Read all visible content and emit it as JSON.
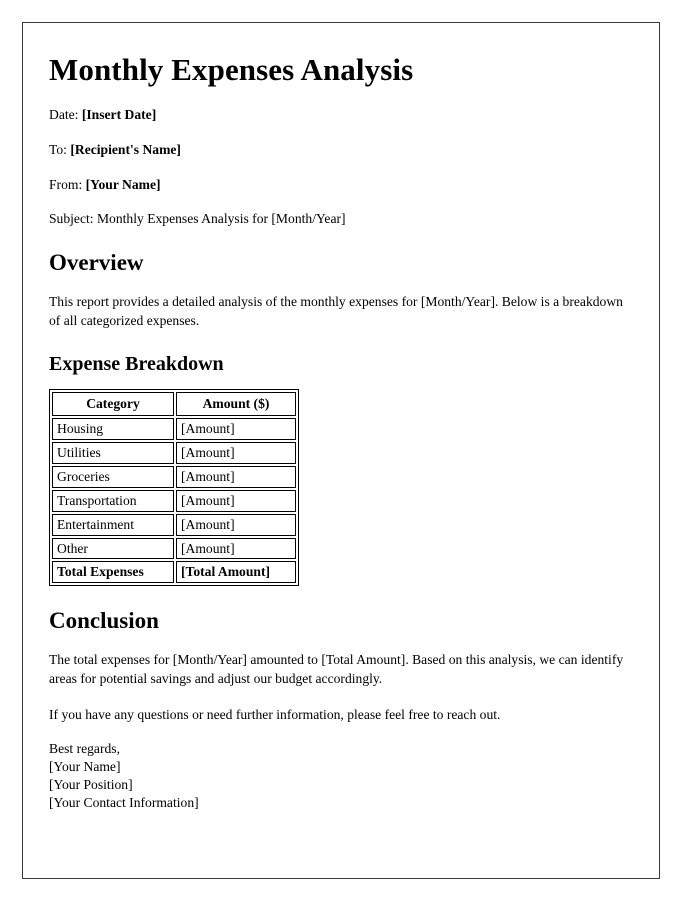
{
  "document": {
    "title": "Monthly Expenses Analysis",
    "meta": [
      {
        "label": "Date:",
        "value": "[Insert Date]",
        "bold_value": true
      },
      {
        "label": "To:",
        "value": "[Recipient's Name]",
        "bold_value": true
      },
      {
        "label": "From:",
        "value": "[Your Name]",
        "bold_value": true
      },
      {
        "label": "Subject:",
        "value": "Monthly Expenses Analysis for [Month/Year]",
        "bold_value": false
      }
    ],
    "overview": {
      "heading": "Overview",
      "paragraph": "This report provides a detailed analysis of the monthly expenses for [Month/Year]. Below is a breakdown of all categorized expenses."
    },
    "expense_breakdown": {
      "heading": "Expense Breakdown",
      "table": {
        "columns": [
          "Category",
          "Amount ($)"
        ],
        "rows": [
          [
            "Housing",
            "[Amount]"
          ],
          [
            "Utilities",
            "[Amount]"
          ],
          [
            "Groceries",
            "[Amount]"
          ],
          [
            "Transportation",
            "[Amount]"
          ],
          [
            "Entertainment",
            "[Amount]"
          ],
          [
            "Other",
            "[Amount]"
          ]
        ],
        "total_row": [
          "Total Expenses",
          "[Total Amount]"
        ]
      }
    },
    "conclusion": {
      "heading": "Conclusion",
      "paragraph_1": "The total expenses for [Month/Year] amounted to [Total Amount]. Based on this analysis, we can identify areas for potential savings and adjust our budget accordingly.",
      "paragraph_2": "If you have any questions or need further information, please feel free to reach out."
    },
    "signature": {
      "closing": "Best regards,",
      "name": "[Your Name]",
      "position": "[Your Position]",
      "contact": "[Your Contact Information]"
    }
  },
  "colors": {
    "page_border": "#3a3a3a",
    "text": "#000000",
    "background": "#ffffff",
    "table_border": "#000000"
  }
}
